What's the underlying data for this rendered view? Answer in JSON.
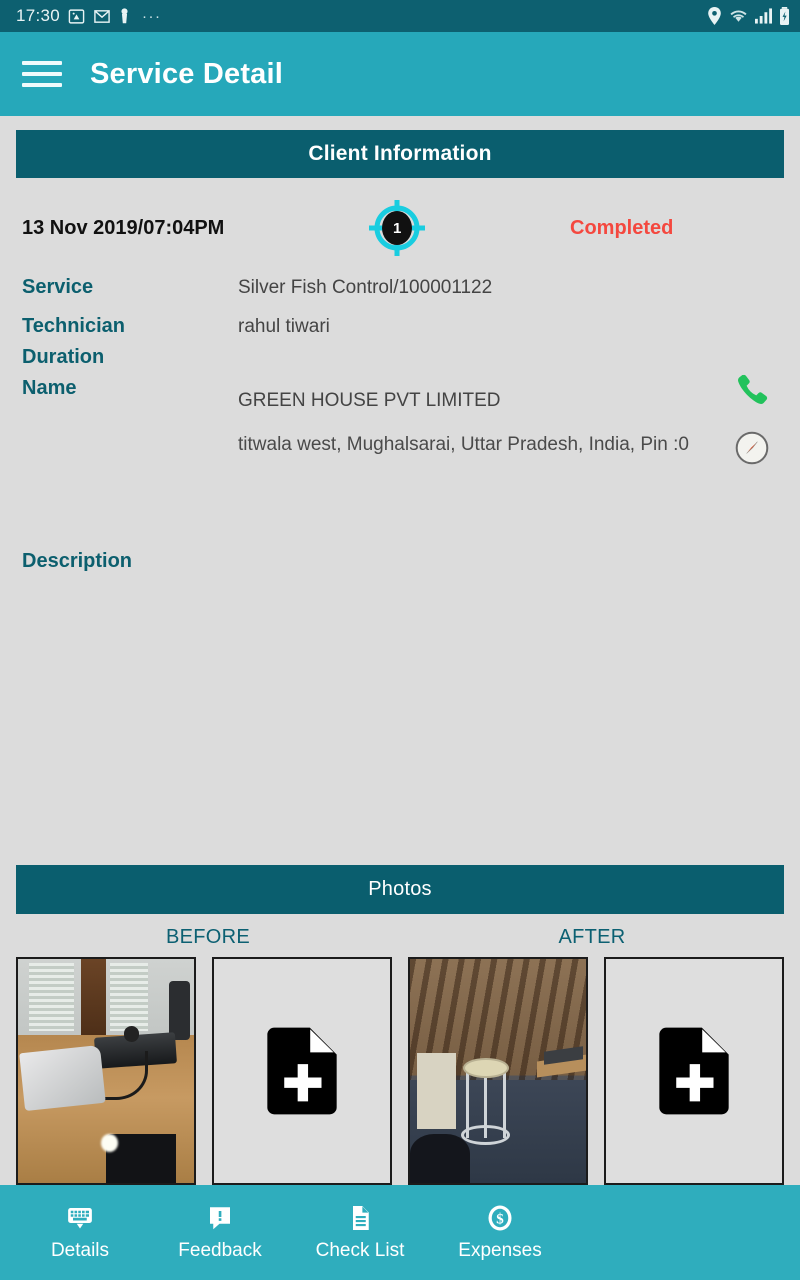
{
  "statusbar": {
    "time": "17:30",
    "overflow": "···",
    "left_icons": [
      "pdf-icon",
      "gmail-icon",
      "person-key-icon"
    ],
    "right_icons": [
      "location-pin-icon",
      "wifi-icon",
      "signal-bars-icon",
      "battery-charging-icon"
    ],
    "bg_color": "#0d6070"
  },
  "appbar": {
    "title": "Service Detail",
    "menu_icon": "hamburger-menu-icon",
    "bg_color": "#26a8ba"
  },
  "client_section": {
    "header": "Client Information",
    "header_bg": "#0a5e6e",
    "date": "13 Nov 2019/07:04PM",
    "badge_count": "1",
    "badge_icon": "target-crosshair-icon",
    "status": "Completed",
    "status_color": "#f4483f",
    "fields": [
      {
        "label": "Service",
        "value": "Silver Fish Control/100001122"
      },
      {
        "label": "Technician",
        "value": "rahul tiwari"
      },
      {
        "label": "Duration",
        "value": ""
      },
      {
        "label": "Name",
        "value": "GREEN HOUSE PVT LIMITED"
      }
    ],
    "address": "titwala west, Mughalsarai, Uttar Pradesh, India, Pin :0",
    "call_icon": "phone-call-icon",
    "navigate_icon": "compass-navigate-icon",
    "description_label": "Description",
    "description_value": ""
  },
  "photos_section": {
    "header": "Photos",
    "header_bg": "#0a5e6e",
    "before_label": "BEFORE",
    "after_label": "AFTER",
    "thumbnails": [
      {
        "group": "before",
        "kind": "photo",
        "name": "before-photo-desk"
      },
      {
        "group": "before",
        "kind": "placeholder",
        "name": "add-before-photo"
      },
      {
        "group": "after",
        "kind": "photo",
        "name": "after-photo-stool"
      },
      {
        "group": "after",
        "kind": "placeholder",
        "name": "add-after-photo"
      }
    ],
    "placeholder_icon": "add-document-icon"
  },
  "bottomnav": {
    "bg_color": "#2fadbd",
    "items": [
      {
        "label": "Details",
        "icon": "keyboard-icon"
      },
      {
        "label": "Feedback",
        "icon": "speech-bubble-alert-icon"
      },
      {
        "label": "Check List",
        "icon": "document-lines-icon"
      },
      {
        "label": "Expenses",
        "icon": "dollar-circle-icon"
      }
    ]
  }
}
